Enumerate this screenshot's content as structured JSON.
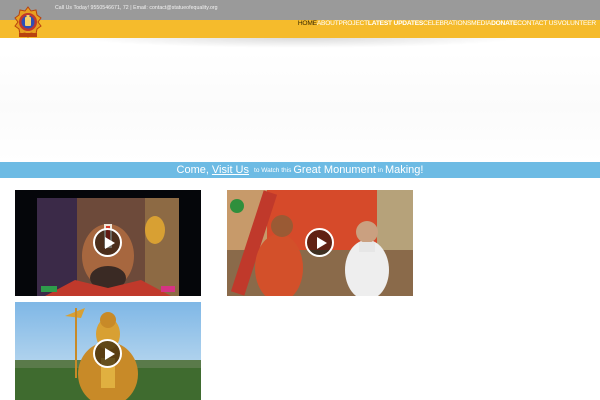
{
  "header": {
    "contact_line": "Call Us Today! 9550546671, 72 | Email: contact@statueofequality.org",
    "logo": "statue-of-equality-emblem"
  },
  "nav": {
    "items": [
      {
        "label": "HOME",
        "active": true,
        "bold": false
      },
      {
        "label": "ABOUT",
        "active": false,
        "bold": false
      },
      {
        "label": "PROJECT",
        "active": false,
        "bold": false
      },
      {
        "label": "LATEST UPDATES",
        "active": false,
        "bold": true
      },
      {
        "label": "CELEBRATIONS",
        "active": false,
        "bold": false
      },
      {
        "label": "MEDIA",
        "active": false,
        "bold": false
      },
      {
        "label": "DONATE",
        "active": false,
        "bold": true
      },
      {
        "label": "CONTACT US",
        "active": false,
        "bold": false
      },
      {
        "label": "VOLUNTEER",
        "active": false,
        "bold": false
      }
    ]
  },
  "banner": {
    "part1": "Come,",
    "link": "Visit Us",
    "part2": "to Watch this",
    "part3": "Great Monument",
    "part4": "in",
    "part5": "Making!"
  },
  "videos": [
    {
      "thumbnail": "saint-with-tilak-closeup",
      "icon": "play-icon"
    },
    {
      "thumbnail": "seer-meeting-leader",
      "icon": "play-icon"
    },
    {
      "thumbnail": "golden-statue-render",
      "icon": "play-icon"
    }
  ],
  "colors": {
    "topbar": "#9a9a9a",
    "navbar": "#f5bb2c",
    "banner": "#6dbbe4",
    "text_light": "#ffffff"
  }
}
